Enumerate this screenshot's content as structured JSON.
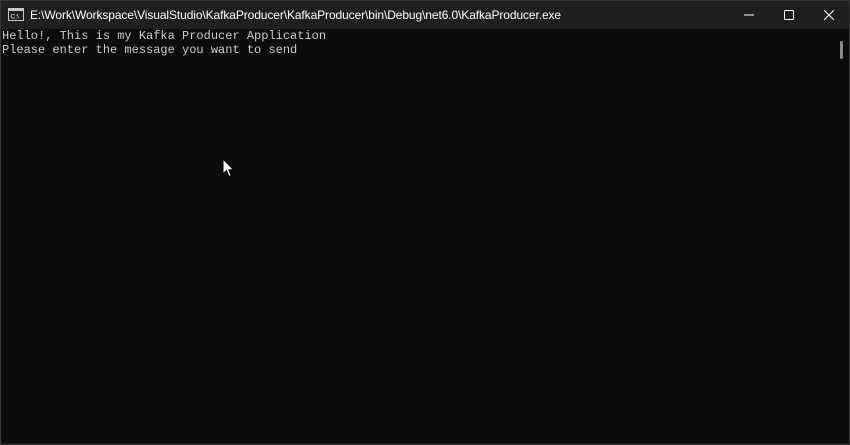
{
  "window": {
    "title": "E:\\Work\\Workspace\\VisualStudio\\KafkaProducer\\KafkaProducer\\bin\\Debug\\net6.0\\KafkaProducer.exe",
    "app_icon": "console-app-icon",
    "controls": {
      "minimize_icon": "minimize-icon",
      "maximize_icon": "maximize-icon",
      "close_icon": "close-icon"
    }
  },
  "console": {
    "lines": [
      "Hello!, This is my Kafka Producer Application",
      "Please enter the message you want to send"
    ]
  },
  "colors": {
    "background": "#0c0c0c",
    "titlebar": "#1f1f1f",
    "text": "#cccccc"
  }
}
